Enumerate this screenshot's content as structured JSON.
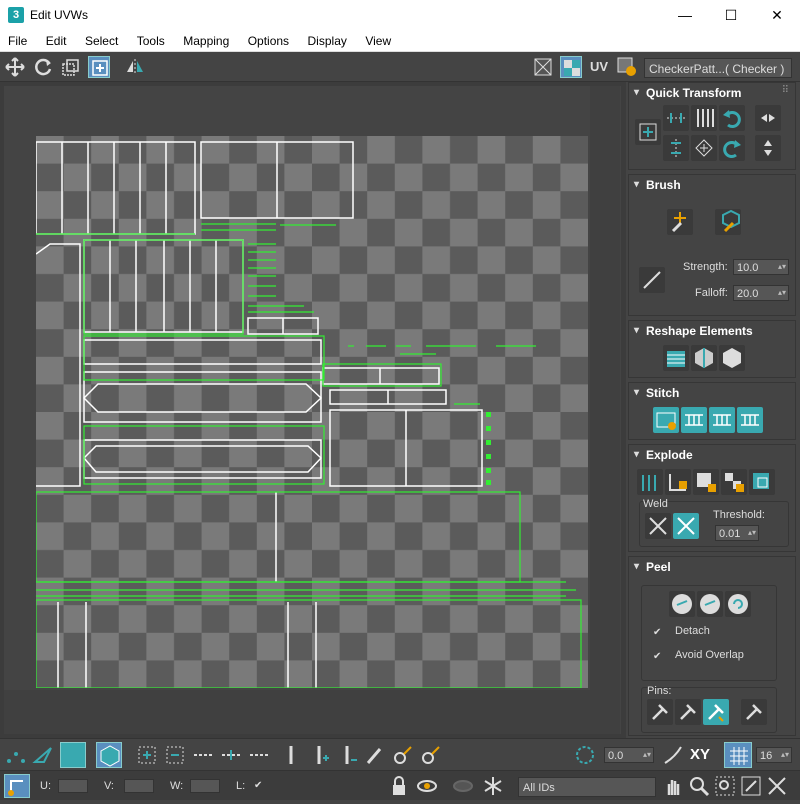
{
  "window": {
    "app_icon": "3",
    "title": "Edit UVWs",
    "minimize": "—",
    "maximize": "☐",
    "close": "✕"
  },
  "menu": [
    "File",
    "Edit",
    "Select",
    "Tools",
    "Mapping",
    "Options",
    "Display",
    "View"
  ],
  "toolbar": {
    "uv_label": "UV",
    "checker_select": "CheckerPatt...( Checker )"
  },
  "panels": {
    "quick_transform": {
      "title": "Quick Transform"
    },
    "brush": {
      "title": "Brush",
      "strength_label": "Strength:",
      "strength_value": "10.0",
      "falloff_label": "Falloff:",
      "falloff_value": "20.0"
    },
    "reshape": {
      "title": "Reshape Elements"
    },
    "stitch": {
      "title": "Stitch"
    },
    "explode": {
      "title": "Explode",
      "weld_label": "Weld",
      "threshold_label": "Threshold:",
      "threshold_value": "0.01"
    },
    "peel": {
      "title": "Peel",
      "detach_label": "Detach",
      "avoid_overlap_label": "Avoid Overlap",
      "pins_label": "Pins:"
    }
  },
  "bottom": {
    "angle_value": "0.0",
    "xy_label": "XY",
    "grid_value": "16"
  },
  "status": {
    "u_label": "U:",
    "v_label": "V:",
    "w_label": "W:",
    "l_label": "L:",
    "ids_select": "All IDs"
  },
  "colors": {
    "accent": "#39a9b0",
    "uv_white": "#ffffff",
    "uv_green": "#33ee33"
  }
}
